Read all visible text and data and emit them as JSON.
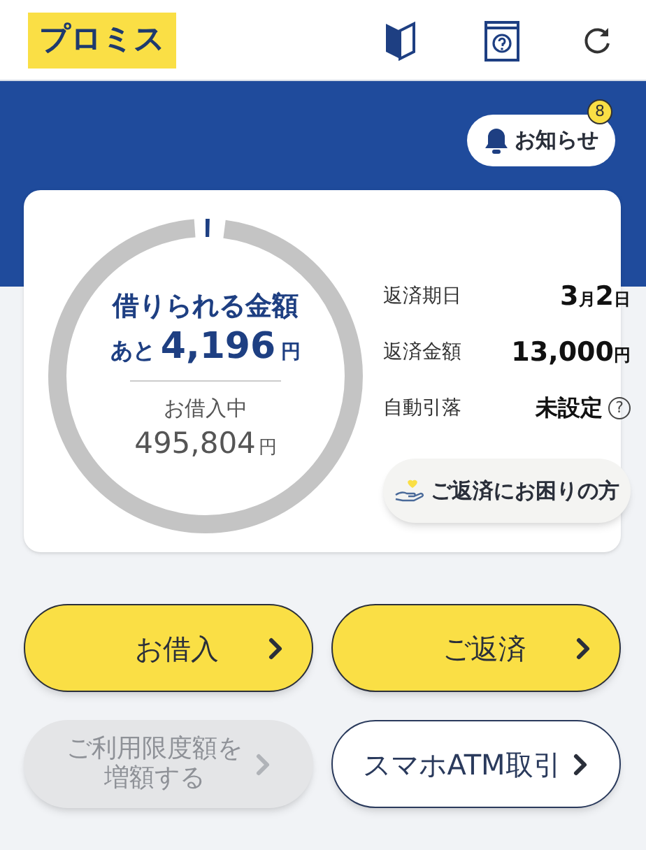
{
  "header": {
    "logo": "プロミス"
  },
  "notification": {
    "label": "お知らせ",
    "badge": "8"
  },
  "summary": {
    "available_label": "借りられる金額",
    "available_prefix": "あと",
    "available_amount": "4,196",
    "available_unit": "円",
    "borrowed_label": "お借入中",
    "borrowed_amount": "495,804",
    "borrowed_unit": "円"
  },
  "details": [
    {
      "label": "返済期日",
      "kind": "parts",
      "parts": [
        {
          "text": "3",
          "small": false
        },
        {
          "text": "月",
          "small": true
        },
        {
          "text": "2",
          "small": false
        },
        {
          "text": "日",
          "small": true
        }
      ]
    },
    {
      "label": "返済金額",
      "kind": "parts",
      "parts": [
        {
          "text": "13,000",
          "small": false
        },
        {
          "text": "円",
          "small": true
        }
      ]
    },
    {
      "label": "自動引落",
      "kind": "help",
      "value": "未設定",
      "help": "?"
    }
  ],
  "help_button": {
    "label": "ご返済にお困りの方"
  },
  "actions": [
    {
      "label": "お借入",
      "kind": "primary",
      "disabled": false
    },
    {
      "label": "ご返済",
      "kind": "primary",
      "disabled": false
    },
    {
      "lines": [
        "ご利用限度額を",
        "増額する"
      ],
      "kind": "multiline",
      "disabled": true
    },
    {
      "label": "スマホATM取引",
      "kind": "outline",
      "disabled": false
    }
  ]
}
